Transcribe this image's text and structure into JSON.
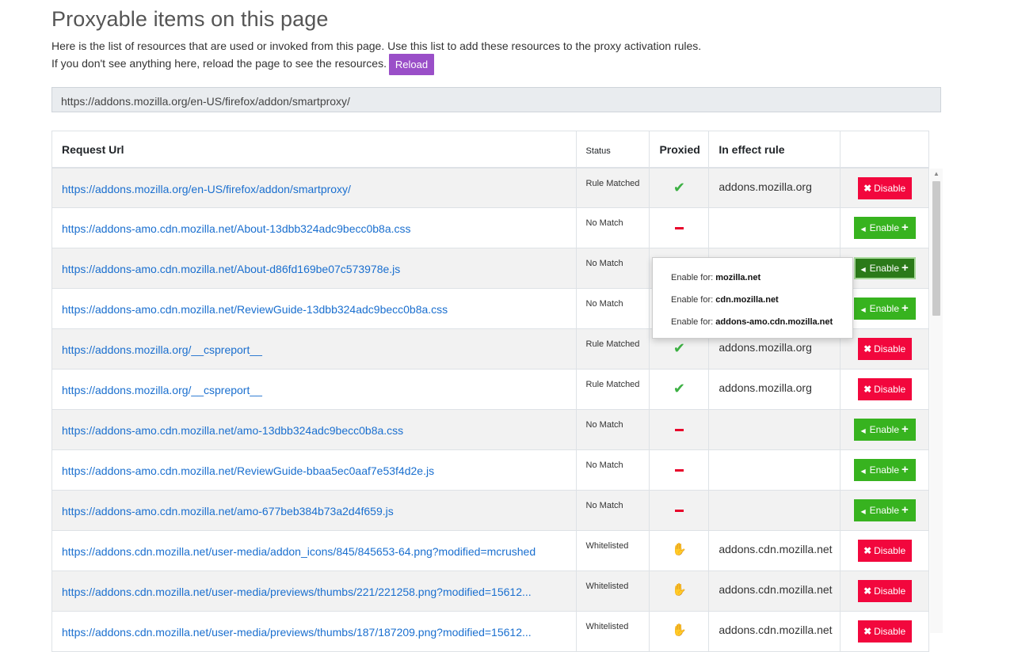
{
  "page": {
    "title": "Proxyable items on this page",
    "description_line1": "Here is the list of resources that are used or invoked from this page. Use this list to add these resources to the proxy activation rules.",
    "description_line2": "If you don't see anything here, reload the page to see the resources.",
    "reload_label": "Reload",
    "current_url": "https://addons.mozilla.org/en-US/firefox/addon/smartproxy/"
  },
  "table": {
    "headers": {
      "request_url": "Request Url",
      "status": "Status",
      "proxied": "Proxied",
      "rule": "In effect rule",
      "action": ""
    },
    "rows": [
      {
        "url": "https://addons.mozilla.org/en-US/firefox/addon/smartproxy/",
        "status": "Rule Matched",
        "proxied": "check",
        "rule": "addons.mozilla.org",
        "action": "Disable"
      },
      {
        "url": "https://addons-amo.cdn.mozilla.net/About-13dbb324adc9becc0b8a.css",
        "status": "No Match",
        "proxied": "dash",
        "rule": "",
        "action": "Enable"
      },
      {
        "url": "https://addons-amo.cdn.mozilla.net/About-d86fd169be07c573978e.js",
        "status": "No Match",
        "proxied": "dash",
        "rule": "",
        "action": "Enable"
      },
      {
        "url": "https://addons-amo.cdn.mozilla.net/ReviewGuide-13dbb324adc9becc0b8a.css",
        "status": "No Match",
        "proxied": "dash",
        "rule": "",
        "action": "Enable"
      },
      {
        "url": "https://addons.mozilla.org/__cspreport__",
        "status": "Rule Matched",
        "proxied": "check",
        "rule": "addons.mozilla.org",
        "action": "Disable"
      },
      {
        "url": "https://addons.mozilla.org/__cspreport__",
        "status": "Rule Matched",
        "proxied": "check",
        "rule": "addons.mozilla.org",
        "action": "Disable"
      },
      {
        "url": "https://addons-amo.cdn.mozilla.net/amo-13dbb324adc9becc0b8a.css",
        "status": "No Match",
        "proxied": "dash",
        "rule": "",
        "action": "Enable"
      },
      {
        "url": "https://addons-amo.cdn.mozilla.net/ReviewGuide-bbaa5ec0aaf7e53f4d2e.js",
        "status": "No Match",
        "proxied": "dash",
        "rule": "",
        "action": "Enable"
      },
      {
        "url": "https://addons-amo.cdn.mozilla.net/amo-677beb384b73a2d4f659.js",
        "status": "No Match",
        "proxied": "dash",
        "rule": "",
        "action": "Enable"
      },
      {
        "url": "https://addons.cdn.mozilla.net/user-media/addon_icons/845/845653-64.png?modified=mcrushed",
        "status": "Whitelisted",
        "proxied": "hand",
        "rule": "addons.cdn.mozilla.net",
        "action": "Disable"
      },
      {
        "url": "https://addons.cdn.mozilla.net/user-media/previews/thumbs/221/221258.png?modified=15612...",
        "status": "Whitelisted",
        "proxied": "hand",
        "rule": "addons.cdn.mozilla.net",
        "action": "Disable"
      },
      {
        "url": "https://addons.cdn.mozilla.net/user-media/previews/thumbs/187/187209.png?modified=15612...",
        "status": "Whitelisted",
        "proxied": "hand",
        "rule": "addons.cdn.mozilla.net",
        "action": "Disable"
      }
    ]
  },
  "dropdown": {
    "prefix": "Enable for:",
    "options": [
      "mozilla.net",
      "cdn.mozilla.net",
      "addons-amo.cdn.mozilla.net"
    ]
  },
  "icons": {
    "check": "check-icon",
    "dash": "minus-icon",
    "hand": "hand-icon",
    "disable": "times-icon",
    "enable_caret": "caret-left-icon",
    "enable_plus": "plus-icon"
  },
  "colors": {
    "reload": "#9a4fc8",
    "disable": "#f2073d",
    "enable": "#37b31f",
    "enable_active": "#2b7a19",
    "link": "#1a6fcf",
    "check": "#3cb043",
    "dash": "#e8002a",
    "hand": "#e8671c"
  }
}
